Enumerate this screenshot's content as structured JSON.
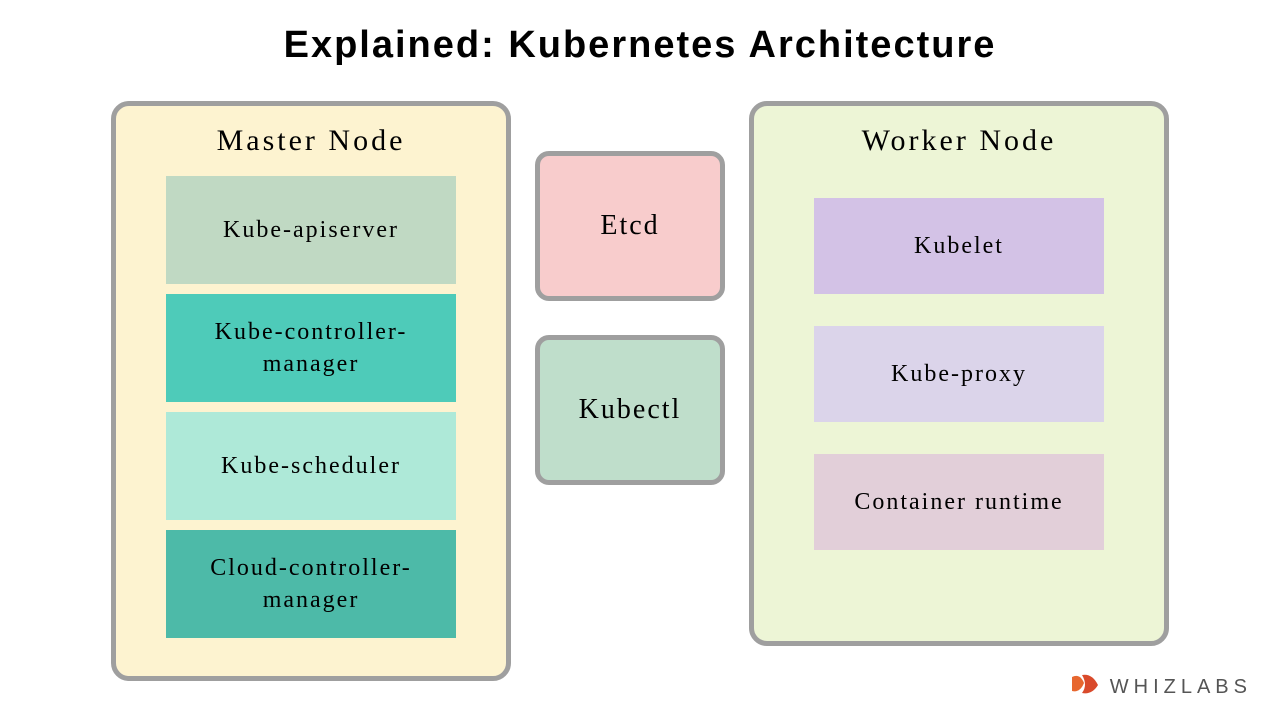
{
  "title": "Explained: Kubernetes Architecture",
  "master_node": {
    "title": "Master Node",
    "components": {
      "apiserver": "Kube-apiserver",
      "controller": "Kube-controller-manager",
      "scheduler": "Kube-scheduler",
      "cloud": "Cloud-controller-manager"
    }
  },
  "middle": {
    "etcd": "Etcd",
    "kubectl": "Kubectl"
  },
  "worker_node": {
    "title": "Worker Node",
    "components": {
      "kubelet": "Kubelet",
      "kubeproxy": "Kube-proxy",
      "container_runtime": "Container runtime"
    }
  },
  "logo": {
    "brand": "WHIZLABS"
  }
}
